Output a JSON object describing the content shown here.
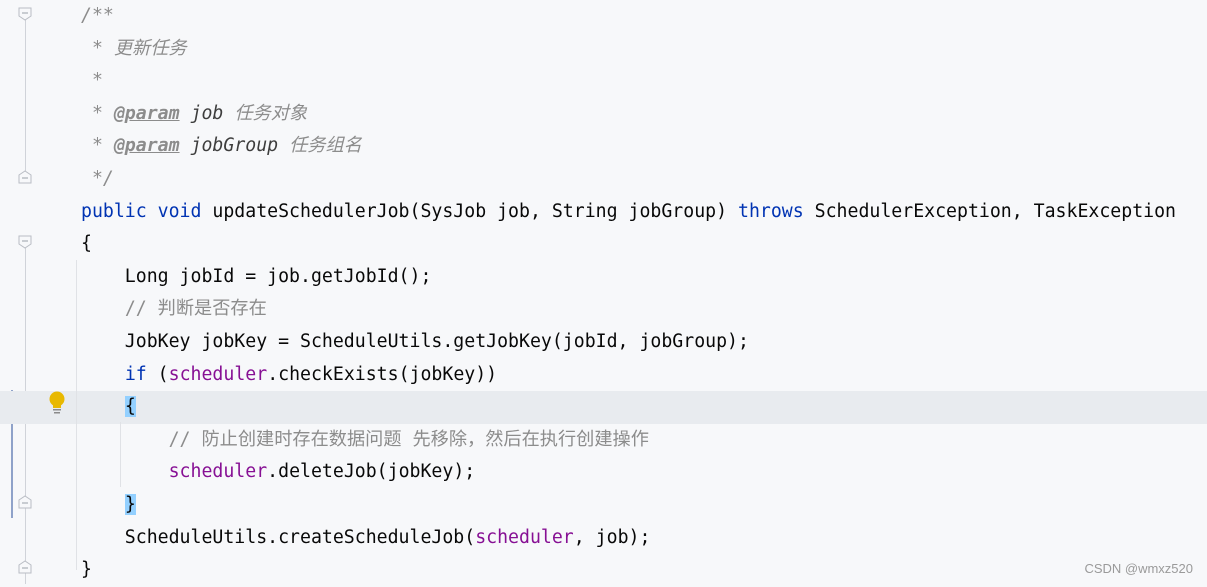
{
  "editor": {
    "lines": [
      {
        "parts": [
          {
            "c": "doc",
            "t": "/**"
          }
        ]
      },
      {
        "parts": [
          {
            "c": "doc",
            "t": " * 更新任务"
          }
        ]
      },
      {
        "parts": [
          {
            "c": "doc",
            "t": " *"
          }
        ]
      },
      {
        "parts": [
          {
            "c": "doc",
            "t": " * "
          },
          {
            "c": "tag",
            "t": "@param"
          },
          {
            "c": "doc",
            "t": " "
          },
          {
            "c": "docp",
            "t": "job"
          },
          {
            "c": "doc",
            "t": " 任务对象"
          }
        ]
      },
      {
        "parts": [
          {
            "c": "doc",
            "t": " * "
          },
          {
            "c": "tag",
            "t": "@param"
          },
          {
            "c": "doc",
            "t": " "
          },
          {
            "c": "docp",
            "t": "jobGroup"
          },
          {
            "c": "doc",
            "t": " 任务组名"
          }
        ]
      },
      {
        "parts": [
          {
            "c": "doc",
            "t": " */"
          }
        ]
      },
      {
        "parts": [
          {
            "c": "kw",
            "t": "public void "
          },
          {
            "c": "",
            "t": "updateSchedulerJob(SysJob job, String jobGroup) "
          },
          {
            "c": "kw",
            "t": "throws "
          },
          {
            "c": "",
            "t": "SchedulerException, TaskException"
          }
        ]
      },
      {
        "parts": [
          {
            "c": "",
            "t": "{"
          }
        ]
      },
      {
        "parts": [
          {
            "c": "",
            "t": "    Long jobId = job.getJobId();"
          }
        ]
      },
      {
        "parts": [
          {
            "c": "",
            "t": "    "
          },
          {
            "c": "cm",
            "t": "// 判断是否存在"
          }
        ]
      },
      {
        "parts": [
          {
            "c": "",
            "t": "    JobKey jobKey = ScheduleUtils.getJobKey(jobId, jobGroup);"
          }
        ]
      },
      {
        "parts": [
          {
            "c": "",
            "t": "    "
          },
          {
            "c": "kw",
            "t": "if "
          },
          {
            "c": "",
            "t": "("
          },
          {
            "c": "fld",
            "t": "scheduler"
          },
          {
            "c": "",
            "t": ".checkExists(jobKey))"
          }
        ]
      },
      {
        "parts": [
          {
            "c": "",
            "t": "    "
          },
          {
            "c": "br",
            "t": "{"
          },
          {
            "c": "caret",
            "t": ""
          }
        ],
        "current": true
      },
      {
        "parts": [
          {
            "c": "",
            "t": "        "
          },
          {
            "c": "cm",
            "t": "// 防止创建时存在数据问题 先移除，然后在执行创建操作"
          }
        ]
      },
      {
        "parts": [
          {
            "c": "",
            "t": "        "
          },
          {
            "c": "fld",
            "t": "scheduler"
          },
          {
            "c": "",
            "t": ".deleteJob(jobKey);"
          }
        ]
      },
      {
        "parts": [
          {
            "c": "",
            "t": "    "
          },
          {
            "c": "br",
            "t": "}"
          }
        ]
      },
      {
        "parts": [
          {
            "c": "",
            "t": "    ScheduleUtils.createScheduleJob("
          },
          {
            "c": "fld",
            "t": "scheduler"
          },
          {
            "c": "",
            "t": ", job);"
          }
        ]
      },
      {
        "parts": [
          {
            "c": "",
            "t": "}"
          }
        ]
      }
    ],
    "gutter_icons": [
      "fold-icon",
      "intention-bulb-icon"
    ]
  },
  "watermark": "CSDN @wmxz520",
  "colors": {
    "keyword": "#0033b3",
    "field": "#871094",
    "comment": "#8c8c8c",
    "bracket_match": "#93d0ff",
    "background": "#f7f8fa"
  }
}
